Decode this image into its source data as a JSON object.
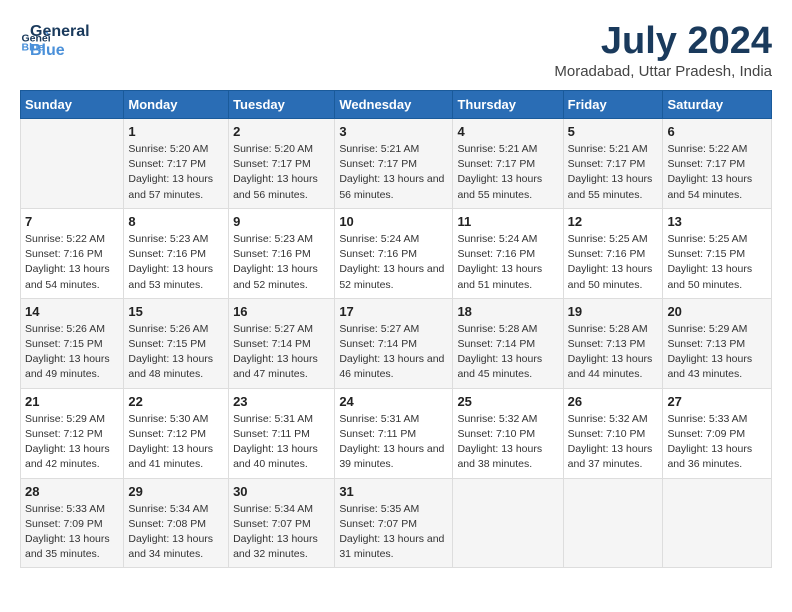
{
  "header": {
    "logo_line1": "General",
    "logo_line2": "Blue",
    "title": "July 2024",
    "subtitle": "Moradabad, Uttar Pradesh, India"
  },
  "weekdays": [
    "Sunday",
    "Monday",
    "Tuesday",
    "Wednesday",
    "Thursday",
    "Friday",
    "Saturday"
  ],
  "weeks": [
    [
      {
        "day": "",
        "sunrise": "",
        "sunset": "",
        "daylight": ""
      },
      {
        "day": "1",
        "sunrise": "Sunrise: 5:20 AM",
        "sunset": "Sunset: 7:17 PM",
        "daylight": "Daylight: 13 hours and 57 minutes."
      },
      {
        "day": "2",
        "sunrise": "Sunrise: 5:20 AM",
        "sunset": "Sunset: 7:17 PM",
        "daylight": "Daylight: 13 hours and 56 minutes."
      },
      {
        "day": "3",
        "sunrise": "Sunrise: 5:21 AM",
        "sunset": "Sunset: 7:17 PM",
        "daylight": "Daylight: 13 hours and 56 minutes."
      },
      {
        "day": "4",
        "sunrise": "Sunrise: 5:21 AM",
        "sunset": "Sunset: 7:17 PM",
        "daylight": "Daylight: 13 hours and 55 minutes."
      },
      {
        "day": "5",
        "sunrise": "Sunrise: 5:21 AM",
        "sunset": "Sunset: 7:17 PM",
        "daylight": "Daylight: 13 hours and 55 minutes."
      },
      {
        "day": "6",
        "sunrise": "Sunrise: 5:22 AM",
        "sunset": "Sunset: 7:17 PM",
        "daylight": "Daylight: 13 hours and 54 minutes."
      }
    ],
    [
      {
        "day": "7",
        "sunrise": "Sunrise: 5:22 AM",
        "sunset": "Sunset: 7:16 PM",
        "daylight": "Daylight: 13 hours and 54 minutes."
      },
      {
        "day": "8",
        "sunrise": "Sunrise: 5:23 AM",
        "sunset": "Sunset: 7:16 PM",
        "daylight": "Daylight: 13 hours and 53 minutes."
      },
      {
        "day": "9",
        "sunrise": "Sunrise: 5:23 AM",
        "sunset": "Sunset: 7:16 PM",
        "daylight": "Daylight: 13 hours and 52 minutes."
      },
      {
        "day": "10",
        "sunrise": "Sunrise: 5:24 AM",
        "sunset": "Sunset: 7:16 PM",
        "daylight": "Daylight: 13 hours and 52 minutes."
      },
      {
        "day": "11",
        "sunrise": "Sunrise: 5:24 AM",
        "sunset": "Sunset: 7:16 PM",
        "daylight": "Daylight: 13 hours and 51 minutes."
      },
      {
        "day": "12",
        "sunrise": "Sunrise: 5:25 AM",
        "sunset": "Sunset: 7:16 PM",
        "daylight": "Daylight: 13 hours and 50 minutes."
      },
      {
        "day": "13",
        "sunrise": "Sunrise: 5:25 AM",
        "sunset": "Sunset: 7:15 PM",
        "daylight": "Daylight: 13 hours and 50 minutes."
      }
    ],
    [
      {
        "day": "14",
        "sunrise": "Sunrise: 5:26 AM",
        "sunset": "Sunset: 7:15 PM",
        "daylight": "Daylight: 13 hours and 49 minutes."
      },
      {
        "day": "15",
        "sunrise": "Sunrise: 5:26 AM",
        "sunset": "Sunset: 7:15 PM",
        "daylight": "Daylight: 13 hours and 48 minutes."
      },
      {
        "day": "16",
        "sunrise": "Sunrise: 5:27 AM",
        "sunset": "Sunset: 7:14 PM",
        "daylight": "Daylight: 13 hours and 47 minutes."
      },
      {
        "day": "17",
        "sunrise": "Sunrise: 5:27 AM",
        "sunset": "Sunset: 7:14 PM",
        "daylight": "Daylight: 13 hours and 46 minutes."
      },
      {
        "day": "18",
        "sunrise": "Sunrise: 5:28 AM",
        "sunset": "Sunset: 7:14 PM",
        "daylight": "Daylight: 13 hours and 45 minutes."
      },
      {
        "day": "19",
        "sunrise": "Sunrise: 5:28 AM",
        "sunset": "Sunset: 7:13 PM",
        "daylight": "Daylight: 13 hours and 44 minutes."
      },
      {
        "day": "20",
        "sunrise": "Sunrise: 5:29 AM",
        "sunset": "Sunset: 7:13 PM",
        "daylight": "Daylight: 13 hours and 43 minutes."
      }
    ],
    [
      {
        "day": "21",
        "sunrise": "Sunrise: 5:29 AM",
        "sunset": "Sunset: 7:12 PM",
        "daylight": "Daylight: 13 hours and 42 minutes."
      },
      {
        "day": "22",
        "sunrise": "Sunrise: 5:30 AM",
        "sunset": "Sunset: 7:12 PM",
        "daylight": "Daylight: 13 hours and 41 minutes."
      },
      {
        "day": "23",
        "sunrise": "Sunrise: 5:31 AM",
        "sunset": "Sunset: 7:11 PM",
        "daylight": "Daylight: 13 hours and 40 minutes."
      },
      {
        "day": "24",
        "sunrise": "Sunrise: 5:31 AM",
        "sunset": "Sunset: 7:11 PM",
        "daylight": "Daylight: 13 hours and 39 minutes."
      },
      {
        "day": "25",
        "sunrise": "Sunrise: 5:32 AM",
        "sunset": "Sunset: 7:10 PM",
        "daylight": "Daylight: 13 hours and 38 minutes."
      },
      {
        "day": "26",
        "sunrise": "Sunrise: 5:32 AM",
        "sunset": "Sunset: 7:10 PM",
        "daylight": "Daylight: 13 hours and 37 minutes."
      },
      {
        "day": "27",
        "sunrise": "Sunrise: 5:33 AM",
        "sunset": "Sunset: 7:09 PM",
        "daylight": "Daylight: 13 hours and 36 minutes."
      }
    ],
    [
      {
        "day": "28",
        "sunrise": "Sunrise: 5:33 AM",
        "sunset": "Sunset: 7:09 PM",
        "daylight": "Daylight: 13 hours and 35 minutes."
      },
      {
        "day": "29",
        "sunrise": "Sunrise: 5:34 AM",
        "sunset": "Sunset: 7:08 PM",
        "daylight": "Daylight: 13 hours and 34 minutes."
      },
      {
        "day": "30",
        "sunrise": "Sunrise: 5:34 AM",
        "sunset": "Sunset: 7:07 PM",
        "daylight": "Daylight: 13 hours and 32 minutes."
      },
      {
        "day": "31",
        "sunrise": "Sunrise: 5:35 AM",
        "sunset": "Sunset: 7:07 PM",
        "daylight": "Daylight: 13 hours and 31 minutes."
      },
      {
        "day": "",
        "sunrise": "",
        "sunset": "",
        "daylight": ""
      },
      {
        "day": "",
        "sunrise": "",
        "sunset": "",
        "daylight": ""
      },
      {
        "day": "",
        "sunrise": "",
        "sunset": "",
        "daylight": ""
      }
    ]
  ]
}
